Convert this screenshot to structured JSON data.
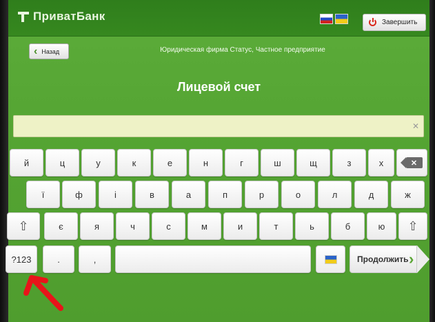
{
  "header": {
    "logo_text": "ПриватБанк",
    "exit_label": "Завершить"
  },
  "nav": {
    "back_label": "Назад",
    "company": "Юридическая фирма Статус, Частное предприятие"
  },
  "page": {
    "title": "Лицевой счет",
    "input_value": ""
  },
  "keyboard": {
    "row1": [
      "й",
      "ц",
      "у",
      "к",
      "е",
      "н",
      "г",
      "ш",
      "щ",
      "з",
      "х"
    ],
    "row2": [
      "ї",
      "ф",
      "і",
      "в",
      "а",
      "п",
      "р",
      "о",
      "л",
      "д",
      "ж"
    ],
    "row3": [
      "є",
      "я",
      "ч",
      "с",
      "м",
      "и",
      "т",
      "ь",
      "б",
      "ю"
    ],
    "symbols_label": "?123",
    "period_label": ".",
    "comma_label": ",",
    "continue_label": "Продолжить"
  },
  "colors": {
    "screen_green": "#55a533",
    "topbar_green": "#2f7e1c",
    "input_bg": "#eef2c6",
    "annotation_red": "#e8141a"
  }
}
